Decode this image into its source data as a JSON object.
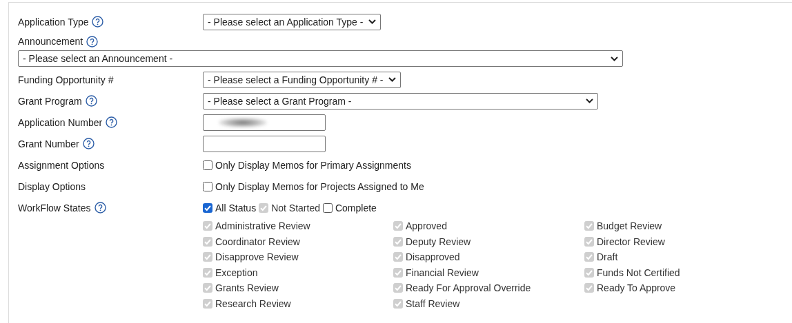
{
  "fields": [
    {
      "kind": "select",
      "label": "Application Type",
      "help": true,
      "value": "- Please select an Application Type -"
    },
    {
      "kind": "blockselect",
      "label": "Announcement",
      "help": true,
      "value": "- Please select an Announcement -"
    },
    {
      "kind": "select",
      "label": "Funding Opportunity #",
      "help": false,
      "value": "- Please select a Funding Opportunity # -"
    },
    {
      "kind": "wideselect",
      "label": "Grant Program",
      "help": true,
      "value": "- Please select a Grant Program -"
    },
    {
      "kind": "text",
      "label": "Application Number",
      "help": true,
      "blurred": true
    },
    {
      "kind": "text",
      "label": "Grant Number",
      "help": true,
      "blurred": false
    },
    {
      "kind": "checkboxes",
      "label": "Assignment Options",
      "help": false,
      "options": [
        {
          "label": "Only Display Memos for Primary Assignments",
          "checked": false,
          "disabled": false
        }
      ]
    },
    {
      "kind": "checkboxes",
      "label": "Display Options",
      "help": false,
      "options": [
        {
          "label": "Only Display Memos for Projects Assigned to Me",
          "checked": false,
          "disabled": false
        }
      ]
    },
    {
      "kind": "checkboxes",
      "label": "WorkFlow States",
      "help": true,
      "options": [
        {
          "label": "All Status",
          "checked": true,
          "disabled": false
        },
        {
          "label": "Not Started",
          "checked": true,
          "disabled": true
        },
        {
          "label": "Complete",
          "checked": false,
          "disabled": false
        }
      ]
    }
  ],
  "states": [
    {
      "label": "Administrative Review",
      "checked": true,
      "disabled": true
    },
    {
      "label": "Approved",
      "checked": true,
      "disabled": true
    },
    {
      "label": "Budget Review",
      "checked": true,
      "disabled": true
    },
    {
      "label": "Coordinator Review",
      "checked": true,
      "disabled": true
    },
    {
      "label": "Deputy Review",
      "checked": true,
      "disabled": true
    },
    {
      "label": "Director Review",
      "checked": true,
      "disabled": true
    },
    {
      "label": "Disapprove Review",
      "checked": true,
      "disabled": true
    },
    {
      "label": "Disapproved",
      "checked": true,
      "disabled": true
    },
    {
      "label": "Draft",
      "checked": true,
      "disabled": true
    },
    {
      "label": "Exception",
      "checked": true,
      "disabled": true
    },
    {
      "label": "Financial Review",
      "checked": true,
      "disabled": true
    },
    {
      "label": "Funds Not Certified",
      "checked": true,
      "disabled": true
    },
    {
      "label": "Grants Review",
      "checked": true,
      "disabled": true
    },
    {
      "label": "Ready For Approval Override",
      "checked": true,
      "disabled": true
    },
    {
      "label": "Ready To Approve",
      "checked": true,
      "disabled": true
    },
    {
      "label": "Research Review",
      "checked": true,
      "disabled": true
    },
    {
      "label": "Staff Review",
      "checked": true,
      "disabled": true
    }
  ]
}
